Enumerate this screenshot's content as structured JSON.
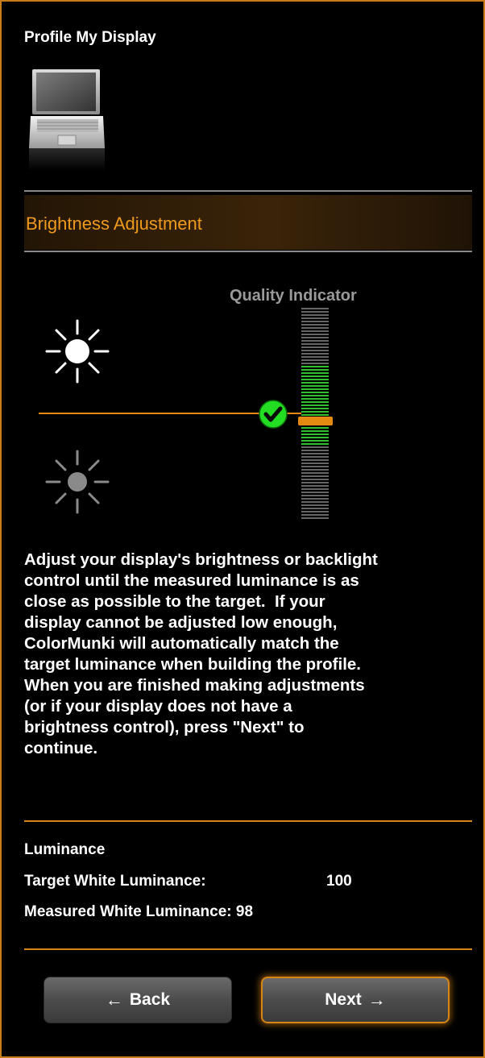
{
  "header": {
    "title": "Profile My Display",
    "icon": "laptop-icon"
  },
  "section": {
    "title": "Brightness Adjustment"
  },
  "quality_indicator": {
    "label": "Quality Indicator",
    "status": "ok",
    "icon": "check-icon"
  },
  "icons": {
    "brighter": "sun-bright-icon",
    "dimmer": "sun-dim-icon"
  },
  "instructions": {
    "lines": [
      "Adjust your display's brightness or backlight",
      "control until the measured luminance is as",
      "close as possible to the target.  If your",
      "display cannot be adjusted low enough,",
      "ColorMunki will automatically match the",
      "target luminance when building the profile.",
      "When you are finished making adjustments",
      "(or if your display does not have a",
      "brightness control), press \"Next\" to",
      "continue."
    ]
  },
  "luminance": {
    "heading": "Luminance",
    "target_label": "Target White Luminance:",
    "target_value": "100",
    "measured_label": "Measured White Luminance:",
    "measured_value": "98"
  },
  "buttons": {
    "back_label": "Back",
    "back_arrow": "←",
    "next_label": "Next",
    "next_arrow": "→"
  },
  "colors": {
    "accent": "#e48a12",
    "section_title": "#ef9a1d",
    "indicator_good": "#2fc12f",
    "check_bg": "#22dd22",
    "frame_border": "#c87d1a"
  }
}
